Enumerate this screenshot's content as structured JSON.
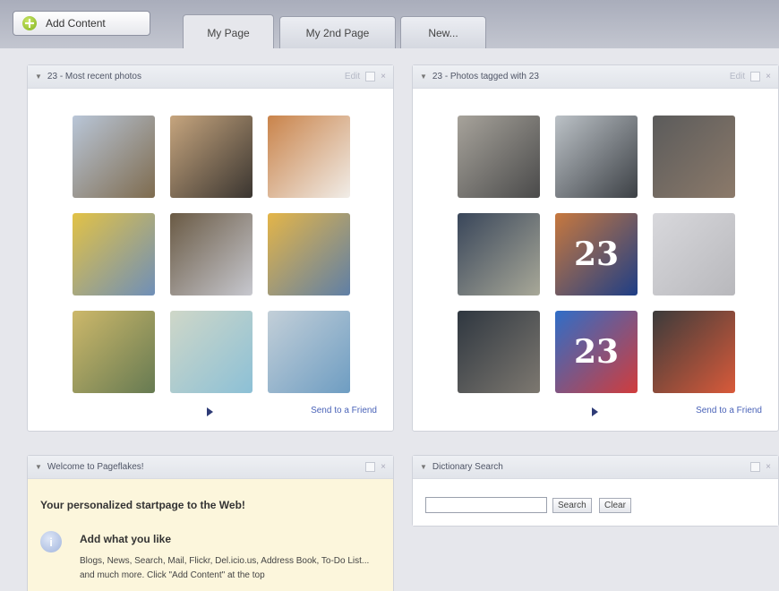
{
  "toolbar": {
    "add_content_label": "Add Content"
  },
  "tabs": [
    {
      "label": "My Page",
      "active": true
    },
    {
      "label": "My 2nd Page",
      "active": false
    },
    {
      "label": "New..."
    }
  ],
  "widgets": {
    "flickr_recent": {
      "title": "23 - Most recent photos",
      "edit_label": "Edit",
      "send_label": "Send to a Friend",
      "thumbs": [
        {
          "colors": [
            "#b9c6d8",
            "#7e6b4e"
          ]
        },
        {
          "colors": [
            "#c6a57e",
            "#3a3530"
          ]
        },
        {
          "colors": [
            "#c9834a",
            "#f1ede8"
          ]
        },
        {
          "colors": [
            "#e2c246",
            "#6f8fb8"
          ]
        },
        {
          "colors": [
            "#6a5a44",
            "#c7c8cf"
          ]
        },
        {
          "colors": [
            "#e4b548",
            "#5f7fa6"
          ]
        },
        {
          "colors": [
            "#cdb86a",
            "#667a52"
          ]
        },
        {
          "colors": [
            "#cfd7c8",
            "#8cc0d6"
          ]
        },
        {
          "colors": [
            "#c3cfd8",
            "#6e9dc2"
          ]
        }
      ]
    },
    "flickr_tagged": {
      "title": "23 - Photos tagged with 23",
      "edit_label": "Edit",
      "send_label": "Send to a Friend",
      "thumbs": [
        {
          "colors": [
            "#a7a39b",
            "#4a4a4a"
          ]
        },
        {
          "colors": [
            "#bcc2c7",
            "#3c4045"
          ]
        },
        {
          "colors": [
            "#5b5b5b",
            "#8c7a6a"
          ]
        },
        {
          "colors": [
            "#39465a",
            "#a8a898"
          ]
        },
        {
          "colors": [
            "#c7783e",
            "#1e3e86"
          ],
          "label": "23"
        },
        {
          "colors": [
            "#d8d8dc",
            "#b8b8bc"
          ]
        },
        {
          "colors": [
            "#2f3740",
            "#7d7870"
          ]
        },
        {
          "colors": [
            "#2f6ec8",
            "#d13c3c"
          ],
          "label": "23"
        },
        {
          "colors": [
            "#3b3b3b",
            "#d95a3a"
          ]
        }
      ]
    },
    "welcome": {
      "title": "Welcome to Pageflakes!",
      "heading": "Your personalized startpage to the Web!",
      "sub_heading": "Add what you like",
      "text": "Blogs, News, Search, Mail, Flickr, Del.icio.us, Address Book, To-Do List... and much more. Click \"Add Content\" at the top"
    },
    "dictionary": {
      "title": "Dictionary Search",
      "input_value": "",
      "search_label": "Search",
      "clear_label": "Clear"
    }
  },
  "colors": {
    "background": "#c9cbd3",
    "page": "#e6e7ec",
    "link": "#4a63b8",
    "welcome_bg": "#fcf6dc"
  }
}
